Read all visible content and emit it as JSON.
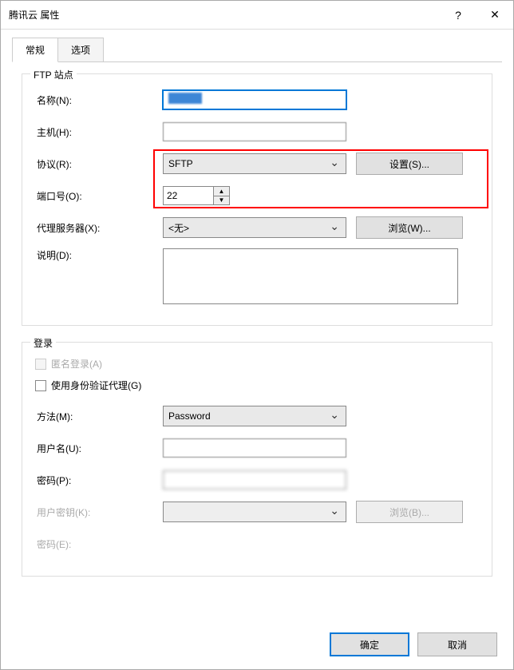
{
  "window": {
    "title": "腾讯云 属性",
    "help_glyph": "?",
    "close_glyph": "✕"
  },
  "tabs": {
    "general": "常规",
    "options": "选项"
  },
  "ftp_site": {
    "legend": "FTP 站点",
    "name_label": "名称(N):",
    "name_value": "my",
    "host_label": "主机(H):",
    "host_value": "",
    "protocol_label": "协议(R):",
    "protocol_value": "SFTP",
    "settings_button": "设置(S)...",
    "port_label": "端口号(O):",
    "port_value": "22",
    "proxy_label": "代理服务器(X):",
    "proxy_value": "<无>",
    "browse_button": "浏览(W)...",
    "description_label": "说明(D):",
    "description_value": ""
  },
  "login": {
    "legend": "登录",
    "anonymous_label": "匿名登录(A)",
    "use_auth_agent_label": "使用身份验证代理(G)",
    "method_label": "方法(M):",
    "method_value": "Password",
    "username_label": "用户名(U):",
    "username_value": "",
    "password_label": "密码(P):",
    "password_value": "",
    "user_key_label": "用户密钥(K):",
    "browse_key_button": "浏览(B)...",
    "password2_label": "密码(E):"
  },
  "footer": {
    "ok": "确定",
    "cancel": "取消"
  }
}
